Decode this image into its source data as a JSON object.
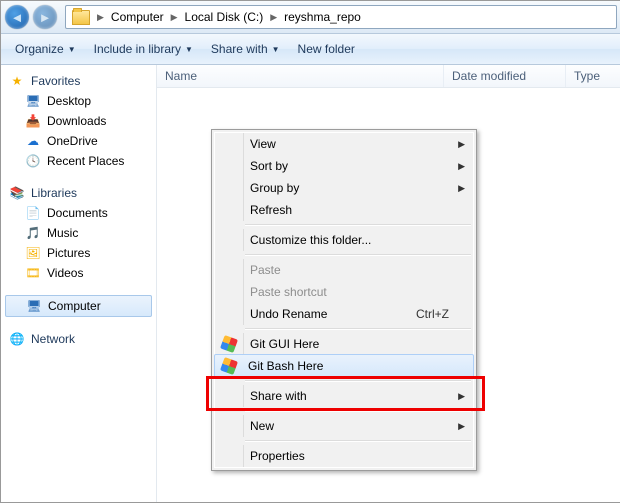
{
  "nav": {
    "crumbs": [
      "Computer",
      "Local Disk (C:)",
      "reyshma_repo"
    ]
  },
  "toolbar": {
    "organize": "Organize",
    "include": "Include in library",
    "share": "Share with",
    "newfolder": "New folder"
  },
  "columns": {
    "name": "Name",
    "date": "Date modified",
    "type": "Type"
  },
  "sidebar": {
    "favorites": {
      "label": "Favorites",
      "items": [
        "Desktop",
        "Downloads",
        "OneDrive",
        "Recent Places"
      ]
    },
    "libraries": {
      "label": "Libraries",
      "items": [
        "Documents",
        "Music",
        "Pictures",
        "Videos"
      ]
    },
    "computer": {
      "label": "Computer"
    },
    "network": {
      "label": "Network"
    }
  },
  "ctx": {
    "view": "View",
    "sort": "Sort by",
    "group": "Group by",
    "refresh": "Refresh",
    "customize": "Customize this folder...",
    "paste": "Paste",
    "paste_sc": "Paste shortcut",
    "undo": "Undo Rename",
    "undo_sc": "Ctrl+Z",
    "gitgui": "Git GUI Here",
    "gitbash": "Git Bash Here",
    "sharewith": "Share with",
    "new": "New",
    "properties": "Properties"
  }
}
